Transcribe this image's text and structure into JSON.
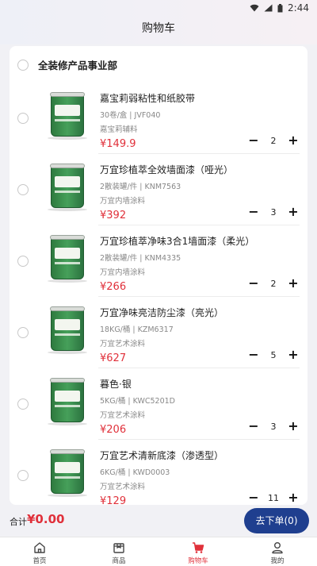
{
  "status": {
    "time": "2:44"
  },
  "header": {
    "title": "购物车"
  },
  "group": {
    "title": "全装修产品事业部"
  },
  "items": [
    {
      "name": "嘉宝莉弱粘性和纸胶带",
      "spec": "30卷/盒 | JVF040",
      "brand": "嘉宝莉辅料",
      "price": "¥149.9",
      "qty": "2"
    },
    {
      "name": "万宜珍植萃全效墙面漆（哑光）",
      "spec": "2散装罐/件 | KNM7563",
      "brand": "万宜内墙涂料",
      "price": "¥392",
      "qty": "3"
    },
    {
      "name": "万宜珍植萃净味3合1墙面漆（柔光）",
      "spec": "2散装罐/件 | KNM4335",
      "brand": "万宜内墙涂料",
      "price": "¥266",
      "qty": "2"
    },
    {
      "name": "万宜净味亮洁防尘漆（亮光）",
      "spec": "18KG/桶 | KZM6317",
      "brand": "万宜艺术涂料",
      "price": "¥627",
      "qty": "5"
    },
    {
      "name": "暮色·银",
      "spec": "5KG/桶 | KWC5201D",
      "brand": "万宜艺术涂料",
      "price": "¥206",
      "qty": "3"
    },
    {
      "name": "万宜艺术清新底漆（渗透型）",
      "spec": "6KG/桶 | KWD0003",
      "brand": "万宜艺术涂料",
      "price": "¥129",
      "qty": "11"
    }
  ],
  "stepper": {
    "minus": "−",
    "plus": "+"
  },
  "footer": {
    "total_label": "合计",
    "total_value": "¥0.00",
    "checkout_label": "去下单(0)"
  },
  "tabs": [
    {
      "label": "首页",
      "icon": "home-icon"
    },
    {
      "label": "商品",
      "icon": "goods-icon"
    },
    {
      "label": "购物车",
      "icon": "cart-icon",
      "active": true
    },
    {
      "label": "我的",
      "icon": "user-icon"
    }
  ],
  "colors": {
    "accent": "#e0303a",
    "primary": "#1f3f8f",
    "product_green": "#2e7a3f"
  }
}
